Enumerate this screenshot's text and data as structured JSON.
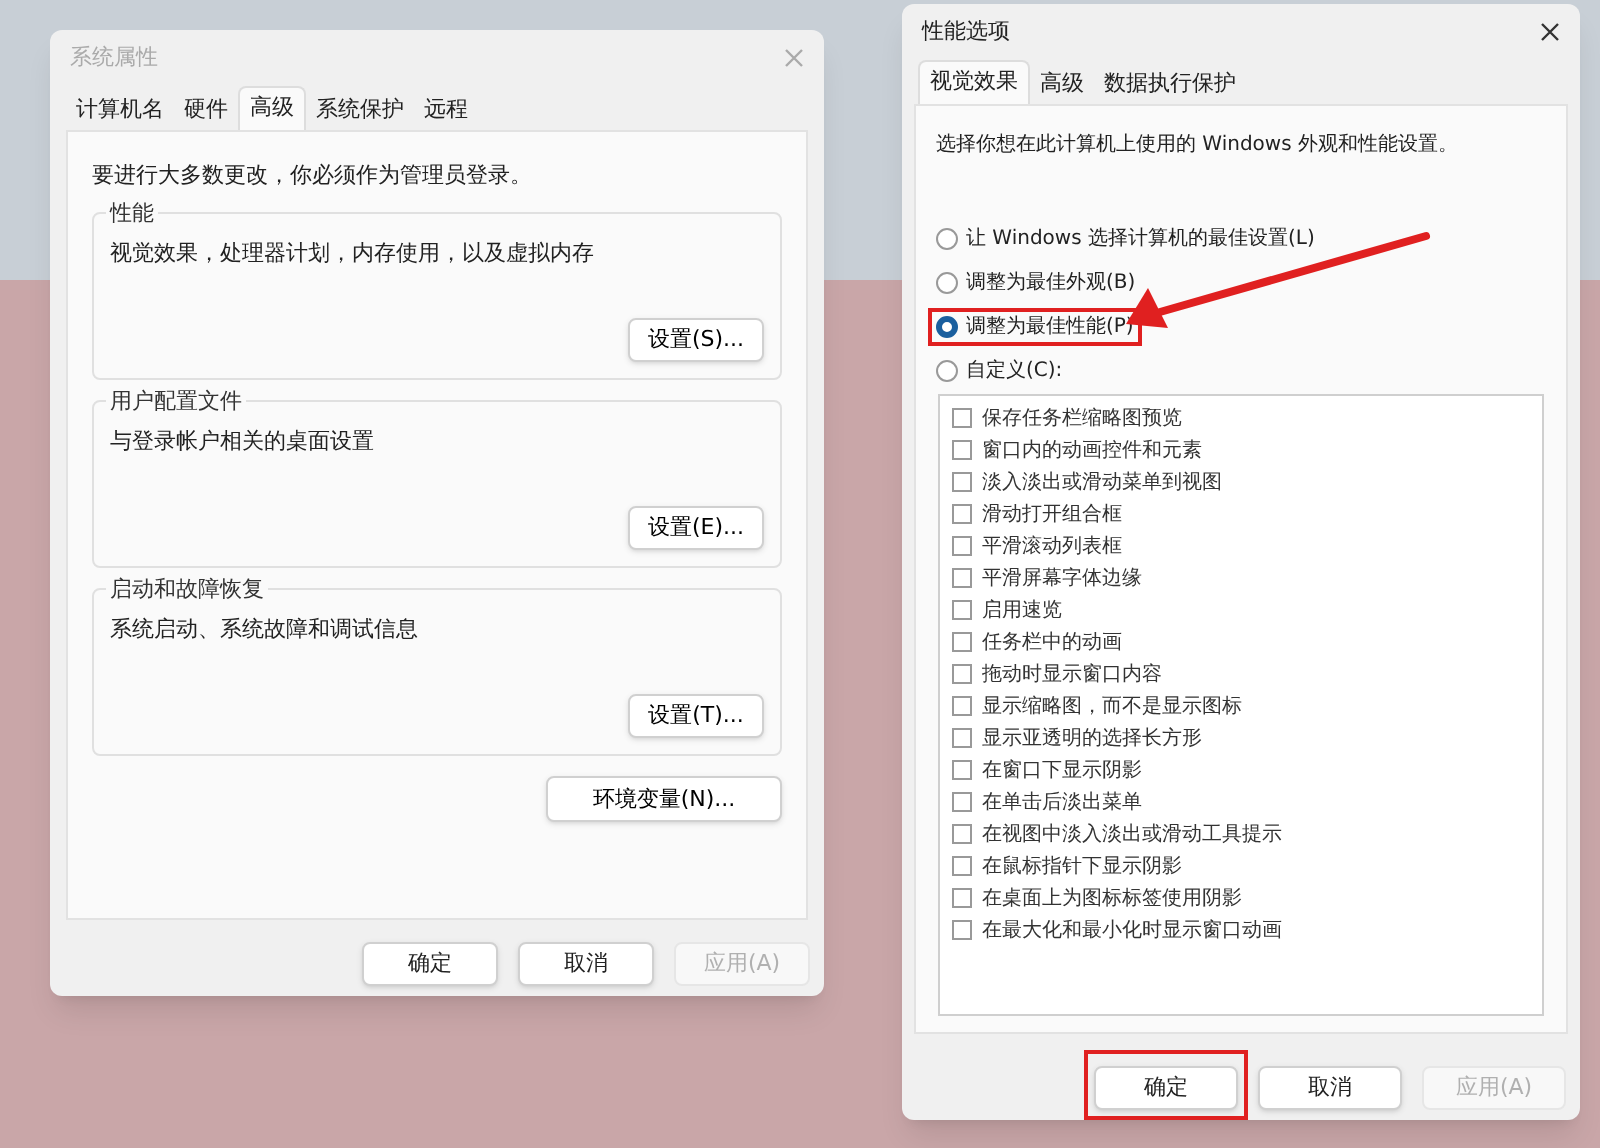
{
  "system_properties": {
    "title": "系统属性",
    "active": false,
    "tabs": [
      {
        "label": "计算机名",
        "selected": false
      },
      {
        "label": "硬件",
        "selected": false
      },
      {
        "label": "高级",
        "selected": true
      },
      {
        "label": "系统保护",
        "selected": false
      },
      {
        "label": "远程",
        "selected": false
      }
    ],
    "admin_note": "要进行大多数更改，你必须作为管理员登录。",
    "groups": [
      {
        "title": "性能",
        "description": "视觉效果，处理器计划，内存使用，以及虚拟内存",
        "button": "设置(S)..."
      },
      {
        "title": "用户配置文件",
        "description": "与登录帐户相关的桌面设置",
        "button": "设置(E)..."
      },
      {
        "title": "启动和故障恢复",
        "description": "系统启动、系统故障和调试信息",
        "button": "设置(T)..."
      }
    ],
    "env_button": "环境变量(N)...",
    "buttons": [
      {
        "label": "确定",
        "disabled": false,
        "highlighted": false
      },
      {
        "label": "取消",
        "disabled": false,
        "highlighted": false
      },
      {
        "label": "应用(A)",
        "disabled": true,
        "highlighted": false
      }
    ]
  },
  "performance_options": {
    "title": "性能选项",
    "active": true,
    "tabs": [
      {
        "label": "视觉效果",
        "selected": true
      },
      {
        "label": "高级",
        "selected": false
      },
      {
        "label": "数据执行保护",
        "selected": false
      }
    ],
    "description": "选择你想在此计算机上使用的 Windows 外观和性能设置。",
    "radios": [
      {
        "label": "让 Windows 选择计算机的最佳设置(L)",
        "selected": false,
        "highlighted": false
      },
      {
        "label": "调整为最佳外观(B)",
        "selected": false,
        "highlighted": false
      },
      {
        "label": "调整为最佳性能(P)",
        "selected": true,
        "highlighted": true
      },
      {
        "label": "自定义(C):",
        "selected": false,
        "highlighted": false
      }
    ],
    "options": [
      {
        "label": "保存任务栏缩略图预览",
        "checked": false
      },
      {
        "label": "窗口内的动画控件和元素",
        "checked": false
      },
      {
        "label": "淡入淡出或滑动菜单到视图",
        "checked": false
      },
      {
        "label": "滑动打开组合框",
        "checked": false
      },
      {
        "label": "平滑滚动列表框",
        "checked": false
      },
      {
        "label": "平滑屏幕字体边缘",
        "checked": false
      },
      {
        "label": "启用速览",
        "checked": false
      },
      {
        "label": "任务栏中的动画",
        "checked": false
      },
      {
        "label": "拖动时显示窗口内容",
        "checked": false
      },
      {
        "label": "显示缩略图，而不是显示图标",
        "checked": false
      },
      {
        "label": "显示亚透明的选择长方形",
        "checked": false
      },
      {
        "label": "在窗口下显示阴影",
        "checked": false
      },
      {
        "label": "在单击后淡出菜单",
        "checked": false
      },
      {
        "label": "在视图中淡入淡出或滑动工具提示",
        "checked": false
      },
      {
        "label": "在鼠标指针下显示阴影",
        "checked": false
      },
      {
        "label": "在桌面上为图标标签使用阴影",
        "checked": false
      },
      {
        "label": "在最大化和最小化时显示窗口动画",
        "checked": false
      }
    ],
    "buttons": [
      {
        "label": "确定",
        "disabled": false,
        "highlighted": true
      },
      {
        "label": "取消",
        "disabled": false,
        "highlighted": false
      },
      {
        "label": "应用(A)",
        "disabled": true,
        "highlighted": false
      }
    ]
  }
}
